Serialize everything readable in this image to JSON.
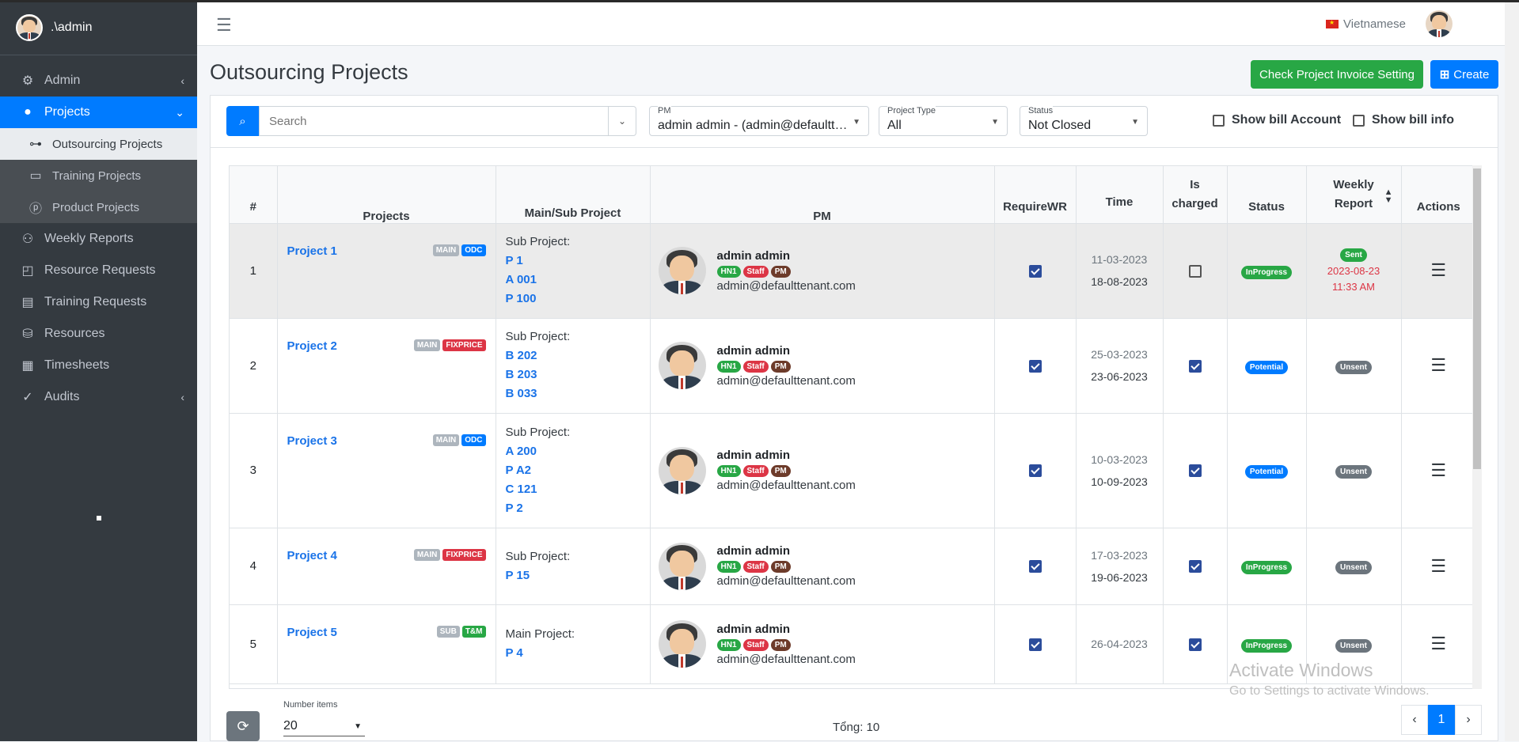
{
  "sidebar": {
    "user": ".\\admin",
    "items": [
      {
        "label": "Admin",
        "icon": "users-cog-icon"
      },
      {
        "label": "Projects",
        "icon": "user-icon"
      },
      {
        "label": "Outsourcing Projects",
        "icon": "sitemap-icon"
      },
      {
        "label": "Training Projects",
        "icon": "laptop-icon"
      },
      {
        "label": "Product Projects",
        "icon": "product-p-icon"
      },
      {
        "label": "Weekly Reports",
        "icon": "weekly-report-icon"
      },
      {
        "label": "Resource Requests",
        "icon": "resource-request-icon"
      },
      {
        "label": "Training Requests",
        "icon": "training-request-icon"
      },
      {
        "label": "Resources",
        "icon": "database-icon"
      },
      {
        "label": "Timesheets",
        "icon": "calendar-icon"
      },
      {
        "label": "Audits",
        "icon": "clipboard-check-icon"
      }
    ]
  },
  "header": {
    "language": "Vietnamese"
  },
  "page": {
    "title": "Outsourcing Projects",
    "check_btn": "Check Project Invoice Setting",
    "create_btn": "Create"
  },
  "filters": {
    "search_placeholder": "Search",
    "pm_label": "PM",
    "pm_value": "admin admin - (admin@defaulttenant.c...",
    "type_label": "Project Type",
    "type_value": "All",
    "status_label": "Status",
    "status_value": "Not Closed",
    "show_bill_account": "Show bill Account",
    "show_bill_info": "Show bill info"
  },
  "table": {
    "headers": {
      "num": "#",
      "projects": "Projects",
      "mainsub": "Main/Sub Project",
      "pm": "PM",
      "requirewr": "RequireWR",
      "time": "Time",
      "charged1": "Is",
      "charged2": "charged",
      "status": "Status",
      "weekly1": "Weekly",
      "weekly2": "Report",
      "actions": "Actions"
    },
    "rows": [
      {
        "num": "1",
        "name": "Project 1",
        "tags": [
          "MAIN",
          "ODC"
        ],
        "sub_label": "Sub Project:",
        "subs": [
          "P 1",
          "A 001",
          "P 100"
        ],
        "pm_name": "admin admin",
        "pm_badges": [
          "HN1",
          "Staff",
          "PM"
        ],
        "pm_email": "admin@defaulttenant.com",
        "require_wr": true,
        "start": "11-03-2023",
        "end": "18-08-2023",
        "charged": false,
        "status": "InProgress",
        "weekly": "Sent",
        "weekly_date": "2023-08-23",
        "weekly_time": "11:33 AM"
      },
      {
        "num": "2",
        "name": "Project 2",
        "tags": [
          "MAIN",
          "FIXPRICE"
        ],
        "sub_label": "Sub Project:",
        "subs": [
          "B 202",
          "B 203",
          "B 033"
        ],
        "pm_name": "admin admin",
        "pm_badges": [
          "HN1",
          "Staff",
          "PM"
        ],
        "pm_email": "admin@defaulttenant.com",
        "require_wr": true,
        "start": "25-03-2023",
        "end": "23-06-2023",
        "charged": true,
        "status": "Potential",
        "weekly": "Unsent"
      },
      {
        "num": "3",
        "name": "Project 3",
        "tags": [
          "MAIN",
          "ODC"
        ],
        "sub_label": "Sub Project:",
        "subs": [
          "A 200",
          "P A2",
          "C 121",
          "P 2"
        ],
        "pm_name": "admin admin",
        "pm_badges": [
          "HN1",
          "Staff",
          "PM"
        ],
        "pm_email": "admin@defaulttenant.com",
        "require_wr": true,
        "start": "10-03-2023",
        "end": "10-09-2023",
        "charged": true,
        "status": "Potential",
        "weekly": "Unsent"
      },
      {
        "num": "4",
        "name": "Project 4",
        "tags": [
          "MAIN",
          "FIXPRICE"
        ],
        "sub_label": "Sub Project:",
        "subs": [
          "P 15"
        ],
        "pm_name": "admin admin",
        "pm_badges": [
          "HN1",
          "Staff",
          "PM"
        ],
        "pm_email": "admin@defaulttenant.com",
        "require_wr": true,
        "start": "17-03-2023",
        "end": "19-06-2023",
        "charged": true,
        "status": "InProgress",
        "weekly": "Unsent"
      },
      {
        "num": "5",
        "name": "Project 5",
        "tags": [
          "SUB",
          "T&M"
        ],
        "sub_label": "Main Project:",
        "subs": [
          "P 4"
        ],
        "pm_name": "admin admin",
        "pm_badges": [
          "HN1",
          "Staff",
          "PM"
        ],
        "pm_email": "admin@defaulttenant.com",
        "require_wr": true,
        "start": "26-04-2023",
        "end": "",
        "charged": true,
        "status": "InProgress",
        "weekly": "Unsent"
      }
    ]
  },
  "footer": {
    "number_items_label": "Number items",
    "number_items": "20",
    "total": "Tổng: 10",
    "page": "1"
  },
  "watermark": {
    "line1": "Activate Windows",
    "line2": "Go to Settings to activate Windows."
  },
  "colors": {
    "primary": "#007bff",
    "success": "#28a745",
    "danger": "#dc3545",
    "sidebar": "#343a40"
  }
}
